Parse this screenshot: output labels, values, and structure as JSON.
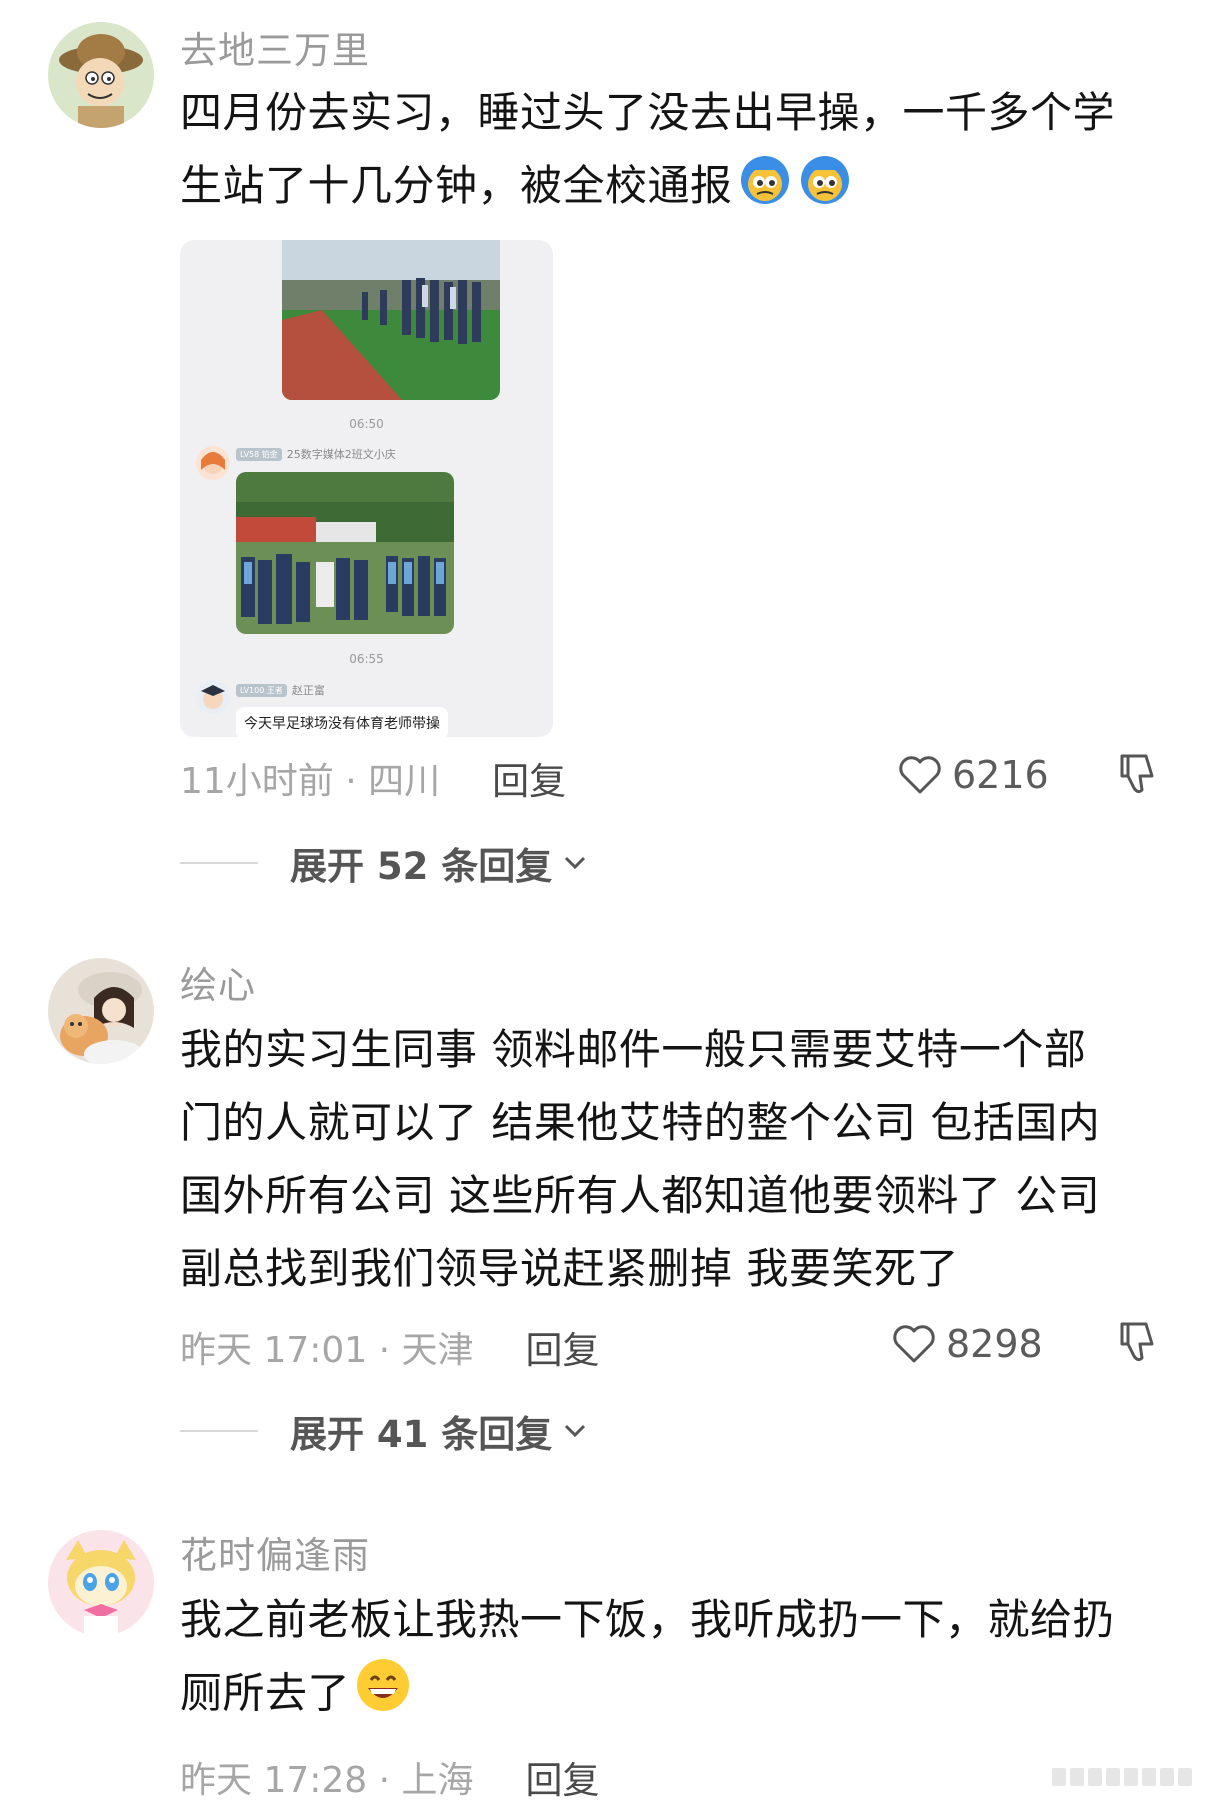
{
  "comments": [
    {
      "username": "去地三万里",
      "content_line1": "四月份去实习，睡过头了没去出早操，一千多个学",
      "content_line2": "生站了十几分钟，被全校通报",
      "emoji": "dizzy-face-emoji",
      "screenshot": {
        "time1": "06:50",
        "user1_badge": "LV58 铂金",
        "user1_name": "25数字媒体2班文小庆",
        "time2": "06:55",
        "user2_badge": "LV100 王者",
        "user2_name": "赵正富",
        "message": "今天早足球场没有体育老师带操"
      },
      "time_location": "11小时前 · 四川",
      "reply_label": "回复",
      "likes": "6216",
      "expand_text": "展开 52 条回复"
    },
    {
      "username": "绘心",
      "content_lines": [
        "我的实习生同事 领料邮件一般只需要艾特一个部",
        "门的人就可以了 结果他艾特的整个公司 包括国内",
        "国外所有公司 这些所有人都知道他要领料了 公司",
        "副总找到我们领导说赶紧删掉 我要笑死了"
      ],
      "time_location": "昨天 17:01 · 天津",
      "reply_label": "回复",
      "likes": "8298",
      "expand_text": "展开 41 条回复"
    },
    {
      "username": "花时偏逢雨",
      "content_line1": "我之前老板让我热一下饭，我听成扔一下，就给扔",
      "content_line2": "厕所去了",
      "emoji": "grinning-face-emoji",
      "time_location": "昨天 17:28 · 上海",
      "reply_label": "回复"
    }
  ],
  "colors": {
    "username": "#9a9a9a",
    "content": "#141414",
    "meta": "#a6a6a6"
  }
}
